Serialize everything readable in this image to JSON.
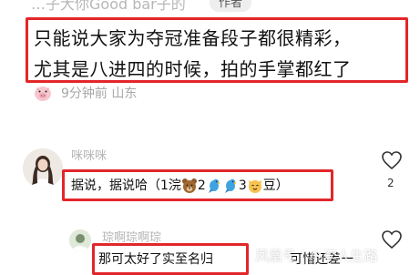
{
  "header": {
    "partial_username": "…子大你Good bar子的",
    "author_tag": "作者"
  },
  "main_comment": {
    "line1": "只能说大家为夺冠准备段子都很精彩，",
    "line2": "尤其是八进四的时候，拍的手掌都红了",
    "time_location": "9分钟前 山东"
  },
  "comment_1": {
    "username": "咪咪咪",
    "text_parts": [
      "据说，据说哈（1浣",
      "2",
      "3",
      "豆）"
    ],
    "likes": "2"
  },
  "comment_2": {
    "username": "琮啊琮啊琮",
    "text": "那可太好了实至名归",
    "tail": "可惜还差一"
  },
  "watermark": "凤凰号 | 小李人生路",
  "colors": {
    "highlight_border": "#e2262a",
    "muted_text": "#a7a7a7"
  }
}
